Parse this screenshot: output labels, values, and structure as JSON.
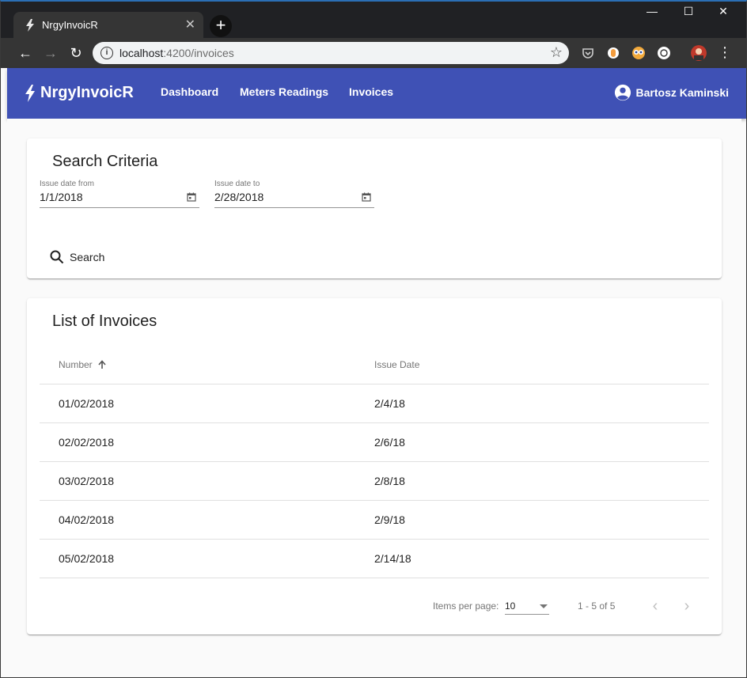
{
  "browser": {
    "tab_title": "NrgyInvoicR",
    "url_host": "localhost",
    "url_path": ":4200/invoices"
  },
  "app": {
    "brand": "NrgyInvoicR",
    "nav": [
      {
        "label": "Dashboard"
      },
      {
        "label": "Meters Readings"
      },
      {
        "label": "Invoices"
      }
    ],
    "user_name": "Bartosz Kaminski",
    "accent_color": "#3f51b5"
  },
  "search": {
    "title": "Search Criteria",
    "from_label": "Issue date from",
    "from_value": "1/1/2018",
    "to_label": "Issue date to",
    "to_value": "2/28/2018",
    "button_label": "Search"
  },
  "invoices": {
    "title": "List of Invoices",
    "columns": [
      "Number",
      "Issue Date"
    ],
    "rows": [
      {
        "number": "01/02/2018",
        "issue_date": "2/4/18"
      },
      {
        "number": "02/02/2018",
        "issue_date": "2/6/18"
      },
      {
        "number": "03/02/2018",
        "issue_date": "2/8/18"
      },
      {
        "number": "04/02/2018",
        "issue_date": "2/9/18"
      },
      {
        "number": "05/02/2018",
        "issue_date": "2/14/18"
      }
    ],
    "paginator": {
      "items_per_page_label": "Items per page:",
      "page_size": "10",
      "range": "1 - 5 of 5"
    }
  }
}
